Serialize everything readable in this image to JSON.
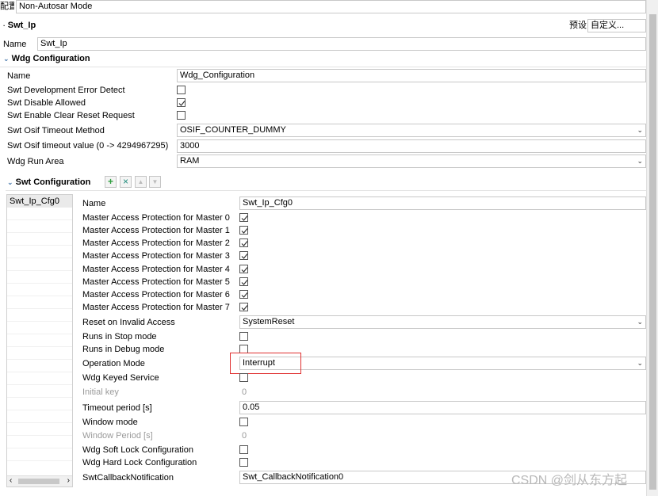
{
  "top": {
    "mode_label": "配置模式",
    "mode_value": "Non-Autosar Mode"
  },
  "module": {
    "title": "Swt_Ip",
    "preset_label": "预设",
    "preset_value": "自定义..."
  },
  "name_row": {
    "label": "Name",
    "value": "Swt_Ip"
  },
  "wdg": {
    "section_title": "Wdg Configuration",
    "name_label": "Name",
    "name_value": "Wdg_Configuration",
    "dev_error_label": "Swt Development Error Detect",
    "dev_error_checked": false,
    "disable_allowed_label": "Swt Disable Allowed",
    "disable_allowed_checked": true,
    "clear_reset_label": "Swt Enable Clear Reset Request",
    "clear_reset_checked": false,
    "osif_method_label": "Swt Osif Timeout Method",
    "osif_method_value": "OSIF_COUNTER_DUMMY",
    "osif_timeout_label": "Swt Osif timeout value (0 -> 4294967295)",
    "osif_timeout_value": "3000",
    "run_area_label": "Wdg Run Area",
    "run_area_value": "RAM"
  },
  "swt": {
    "section_title": "Swt Configuration",
    "toolbar": {
      "add_icon": "plus-icon",
      "remove_icon": "x-icon",
      "up_icon": "arrow-up-icon",
      "down_icon": "arrow-down-icon"
    },
    "list_items": [
      "Swt_Ip_Cfg0"
    ],
    "name_label": "Name",
    "name_value": "Swt_Ip_Cfg0",
    "masters": [
      {
        "label": "Master Access Protection for Master 0",
        "checked": true
      },
      {
        "label": "Master Access Protection for Master 1",
        "checked": true
      },
      {
        "label": "Master Access Protection for Master 2",
        "checked": true
      },
      {
        "label": "Master Access Protection for Master 3",
        "checked": true
      },
      {
        "label": "Master Access Protection for Master 4",
        "checked": true
      },
      {
        "label": "Master Access Protection for Master 5",
        "checked": true
      },
      {
        "label": "Master Access Protection for Master 6",
        "checked": true
      },
      {
        "label": "Master Access Protection for Master 7",
        "checked": true
      }
    ],
    "reset_label": "Reset on Invalid Access",
    "reset_value": "SystemReset",
    "stop_label": "Runs in Stop mode",
    "stop_checked": false,
    "debug_label": "Runs in Debug mode",
    "debug_checked": false,
    "op_mode_label": "Operation Mode",
    "op_mode_value": "Interrupt",
    "keyed_label": "Wdg Keyed Service",
    "keyed_checked": false,
    "initial_key_label": "Initial key",
    "initial_key_value": "0",
    "timeout_label": "Timeout period [s]",
    "timeout_value": "0.05",
    "window_mode_label": "Window mode",
    "window_mode_checked": false,
    "window_period_label": "Window Period [s]",
    "window_period_value": "0",
    "soft_lock_label": "Wdg Soft Lock Configuration",
    "soft_lock_checked": false,
    "hard_lock_label": "Wdg Hard Lock Configuration",
    "hard_lock_checked": false,
    "callback_label": "SwtCallbackNotification",
    "callback_value": "Swt_CallbackNotification0"
  },
  "watermark": "CSDN @剑从东方起",
  "colors": {
    "highlight_box": "#e03030",
    "add_green": "#2e9e3e",
    "remove_red": "#1d8a7a",
    "section_bg": "#ffffff"
  }
}
